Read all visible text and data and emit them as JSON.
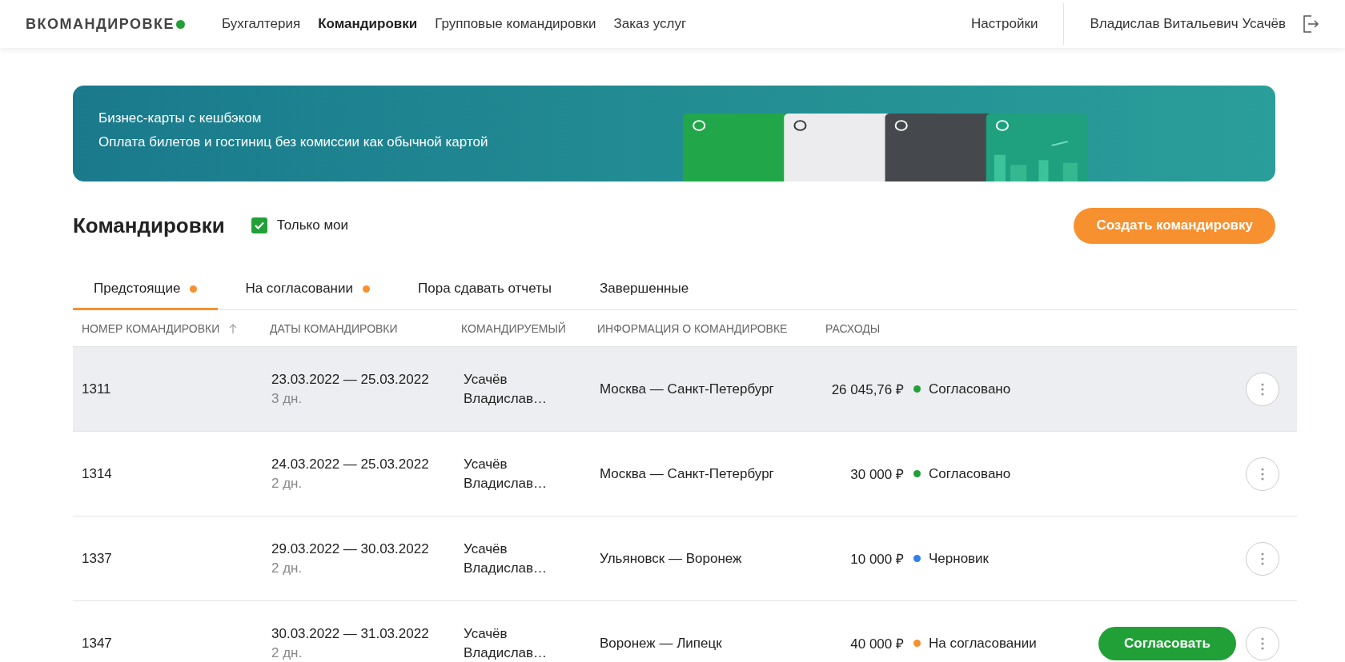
{
  "header": {
    "logo": "ВКОМАНДИРОВКЕ",
    "nav": [
      {
        "label": "Бухгалтерия",
        "selected": false
      },
      {
        "label": "Командировки",
        "selected": true
      },
      {
        "label": "Групповые командировки",
        "selected": false
      },
      {
        "label": "Заказ услуг",
        "selected": false
      }
    ],
    "settings": "Настройки",
    "user": "Владислав Витальевич Усачёв"
  },
  "banner": {
    "title": "Бизнес-карты с кешбэком",
    "subtitle": "Оплата билетов и гостиниц без комиссии как обычной картой",
    "kind": "picture"
  },
  "page_title": "Командировки",
  "only_mine": {
    "label": "Только мои",
    "checked": true
  },
  "create_button": "Создать командировку",
  "tabs": [
    {
      "label": "Предстоящие",
      "selected": true,
      "dot": true
    },
    {
      "label": "На согласовании",
      "selected": false,
      "dot": true
    },
    {
      "label": "Пора сдавать отчеты",
      "selected": false,
      "dot": false
    },
    {
      "label": "Завершенные",
      "selected": false,
      "dot": false
    }
  ],
  "table": {
    "columns": [
      {
        "label": "НОМЕР КОМАНДИРОВКИ",
        "sorted": true
      },
      {
        "label": "ДАТЫ КОМАНДИРОВКИ",
        "sorted": false
      },
      {
        "label": "КОМАНДИРУЕМЫЙ",
        "sorted": false
      },
      {
        "label": "ИНФОРМАЦИЯ О КОМАНДИРОВКЕ",
        "sorted": false
      },
      {
        "label": "РАСХОДЫ",
        "sorted": false
      }
    ],
    "rows": [
      {
        "number": "1311",
        "dates": "23.03.2022 — 25.03.2022",
        "days": "3 дн.",
        "person": [
          "Усачёв",
          "Владислав…"
        ],
        "route": "Москва — Санкт-Петербург",
        "cost": "26 045,76 ₽",
        "status": "Согласовано",
        "color": "#21a038",
        "selected": true
      },
      {
        "number": "1314",
        "dates": "24.03.2022 — 25.03.2022",
        "days": "2 дн.",
        "person": [
          "Усачёв",
          "Владислав…"
        ],
        "route": "Москва — Санкт-Петербург",
        "cost": "30 000 ₽",
        "status": "Согласовано",
        "color": "#21a038",
        "selected": false
      },
      {
        "number": "1337",
        "dates": "29.03.2022 — 30.03.2022",
        "days": "2 дн.",
        "person": [
          "Усачёв",
          "Владислав…"
        ],
        "route": "Ульяновск — Воронеж",
        "cost": "10 000 ₽",
        "status": "Черновик",
        "color": "#2f80ed",
        "selected": false
      },
      {
        "number": "1347",
        "dates": "30.03.2022 — 31.03.2022",
        "days": "2 дн.",
        "person": [
          "Усачёв",
          "Владислав…"
        ],
        "route": "Воронеж — Липецк",
        "cost": "40 000 ₽",
        "status": "На согласовании",
        "color": "#f7902f",
        "selected": false,
        "action": "Согласовать"
      }
    ]
  }
}
